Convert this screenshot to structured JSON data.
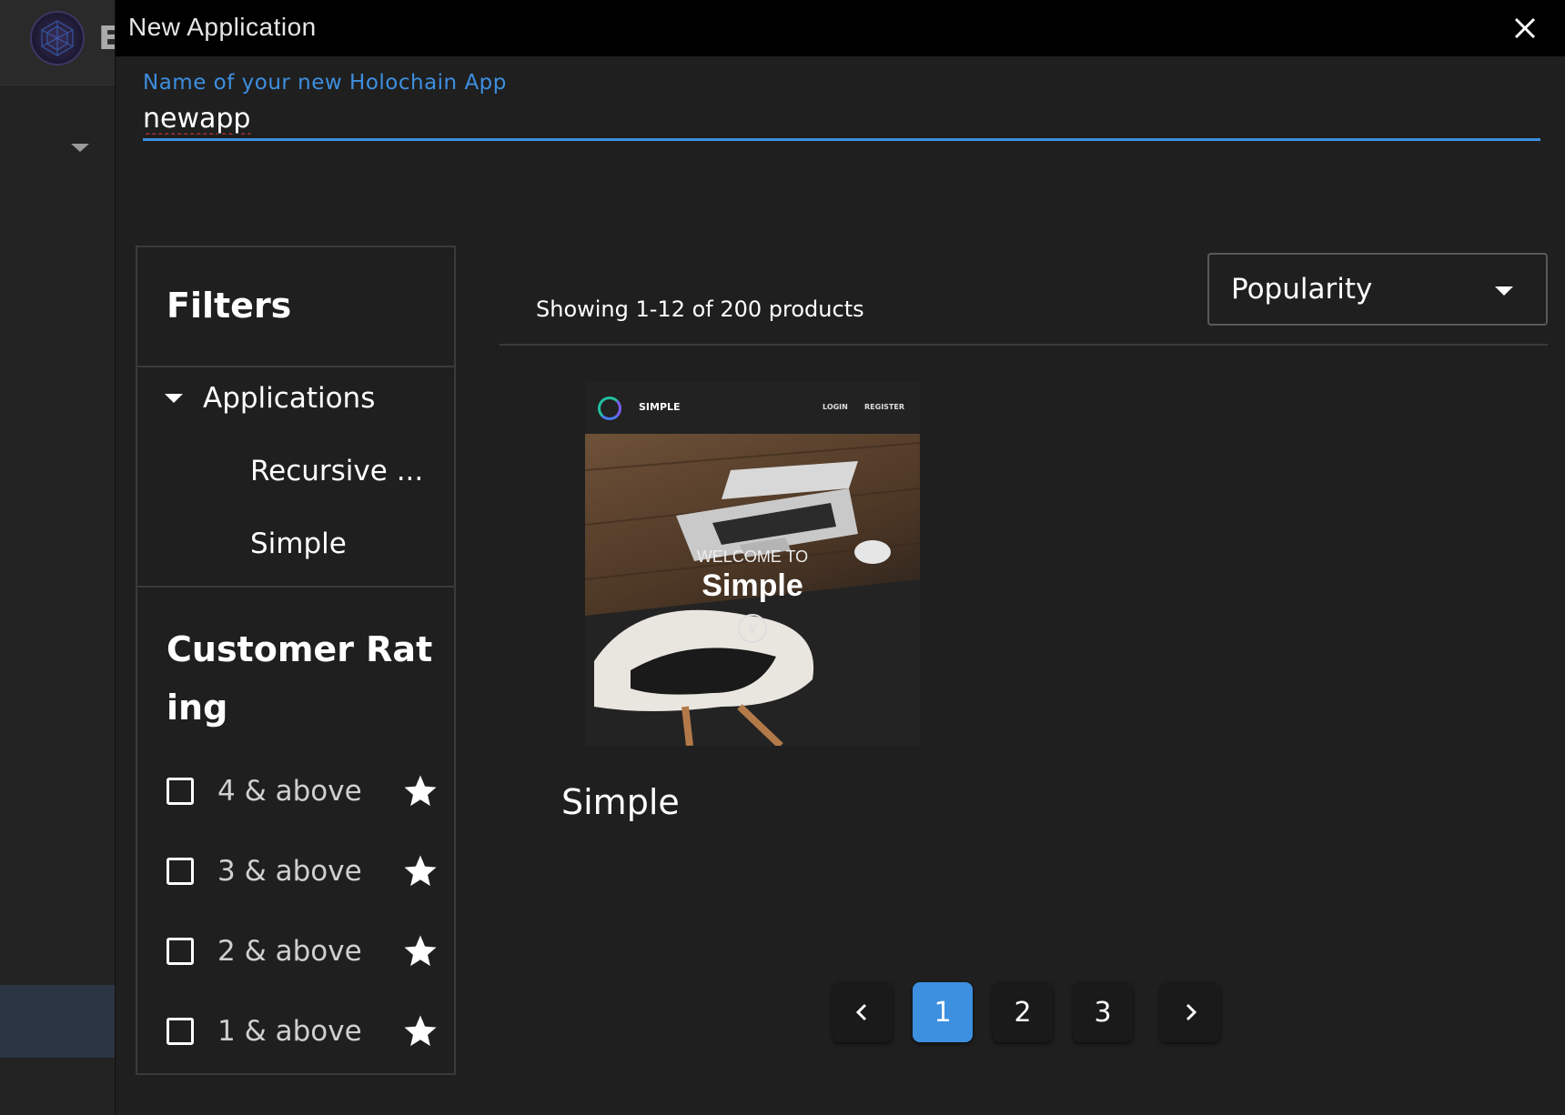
{
  "background_app": {
    "partial_title_letter": "E"
  },
  "dialog": {
    "title": "New Application",
    "close_icon": "close-icon"
  },
  "name_field": {
    "label": "Name of your new Holochain App",
    "value": "newapp"
  },
  "filters": {
    "title": "Filters",
    "applications": {
      "label": "Applications",
      "items": [
        {
          "label": "Recursive ..."
        },
        {
          "label": "Simple"
        }
      ]
    },
    "customer_rating": {
      "title": "Customer Rating",
      "options": [
        {
          "label": "4 & above",
          "checked": false
        },
        {
          "label": "3 & above",
          "checked": false
        },
        {
          "label": "2 & above",
          "checked": false
        },
        {
          "label": "1 & above",
          "checked": false
        }
      ]
    }
  },
  "results": {
    "showing_text": "Showing 1-12 of 200 products",
    "sort": {
      "selected": "Popularity"
    },
    "products": [
      {
        "name": "Simple",
        "thumbnail": {
          "brand": "SIMPLE",
          "nav_links": [
            "LOGIN",
            "REGISTER"
          ],
          "welcome": "WELCOME TO",
          "heading": "Simple"
        }
      }
    ]
  },
  "pagination": {
    "prev_icon": "chevron-left-icon",
    "pages": [
      "1",
      "2",
      "3"
    ],
    "current": "1",
    "next_icon": "chevron-right-icon"
  },
  "colors": {
    "accent": "#3d8fe0",
    "background": "#1f1f1f",
    "header": "#000000"
  }
}
